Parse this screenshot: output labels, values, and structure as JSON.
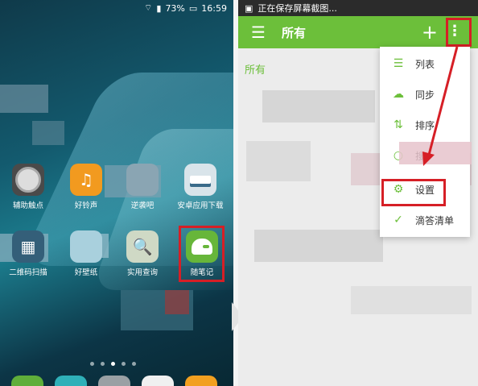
{
  "left_screen": {
    "status": {
      "battery": "73%",
      "time": "16:59"
    },
    "apps_row1": [
      {
        "label": "辅助触点"
      },
      {
        "label": "好铃声"
      },
      {
        "label": "逆袭吧"
      },
      {
        "label": "安卓应用下载"
      }
    ],
    "apps_row2": [
      {
        "label": "二维码扫描"
      },
      {
        "label": "好壁纸"
      },
      {
        "label": "实用查询"
      },
      {
        "label": "随笔记"
      }
    ]
  },
  "right_screen": {
    "status": {
      "text": "正在保存屏幕截图..."
    },
    "appbar": {
      "title": "所有",
      "plus": "+",
      "more": "⋮",
      "menu": "☰"
    },
    "section_label": "所有",
    "menu_items": [
      {
        "label": "列表"
      },
      {
        "label": "同步"
      },
      {
        "label": "排序"
      },
      {
        "label": "搜"
      },
      {
        "label": "设置"
      },
      {
        "label": "滴答清单"
      }
    ]
  },
  "colors": {
    "accent": "#6cbf3a",
    "highlight": "#d61f26"
  }
}
